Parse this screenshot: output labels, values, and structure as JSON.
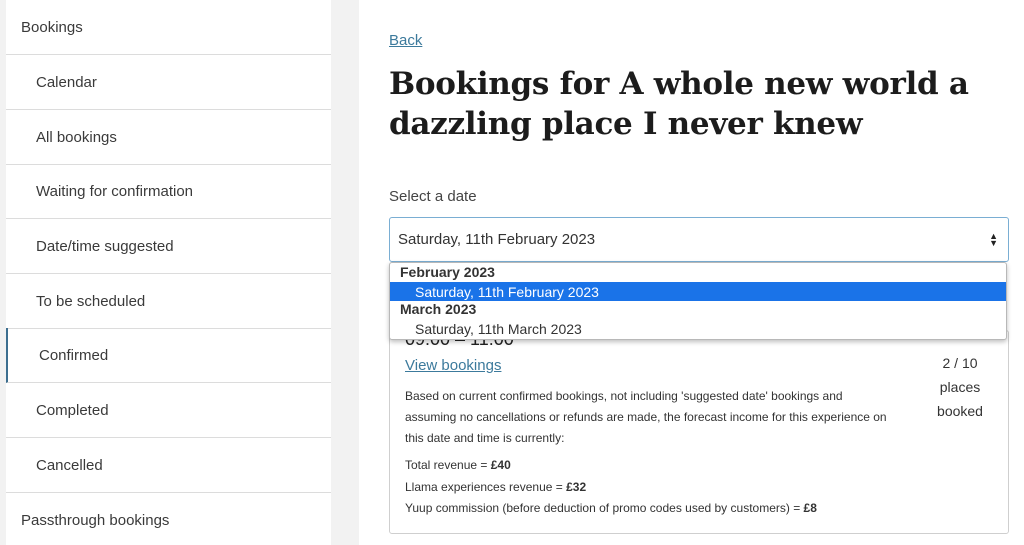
{
  "sidebar": {
    "items": [
      {
        "label": "Bookings"
      },
      {
        "label": "Calendar"
      },
      {
        "label": "All bookings"
      },
      {
        "label": "Waiting for confirmation"
      },
      {
        "label": "Date/time suggested"
      },
      {
        "label": "To be scheduled"
      },
      {
        "label": "Confirmed"
      },
      {
        "label": "Completed"
      },
      {
        "label": "Cancelled"
      },
      {
        "label": "Passthrough bookings"
      }
    ]
  },
  "main": {
    "back_label": "Back",
    "title": "Bookings for A whole new world a dazzling place I never knew",
    "select_label": "Select a date",
    "selected_date": "Saturday, 11th February 2023",
    "dropdown": {
      "groups": [
        {
          "label": "February 2023",
          "options": [
            "Saturday, 11th February 2023"
          ]
        },
        {
          "label": "March 2023",
          "options": [
            "Saturday, 11th March 2023"
          ]
        }
      ]
    },
    "slot": {
      "time": "09:00 – 11:00",
      "view_bookings_label": "View bookings",
      "capacity_count": "2 / 10",
      "capacity_word1": "places",
      "capacity_word2": "booked",
      "forecast_text": "Based on current confirmed bookings, not including 'suggested date' bookings and assuming no cancellations or refunds are made, the forecast income for this experience on this date and time is currently:",
      "total_revenue_label": "Total revenue = ",
      "total_revenue_value": "£40",
      "llama_revenue_label": "Llama experiences revenue = ",
      "llama_revenue_value": "£32",
      "commission_label": "Yuup commission (before deduction of promo codes used by customers) = ",
      "commission_value": "£8"
    }
  },
  "colors": {
    "link": "#3c7a9c",
    "active_border": "#3c6e8f",
    "select_border": "#7aaed3",
    "dropdown_highlight": "#1a73e8"
  }
}
